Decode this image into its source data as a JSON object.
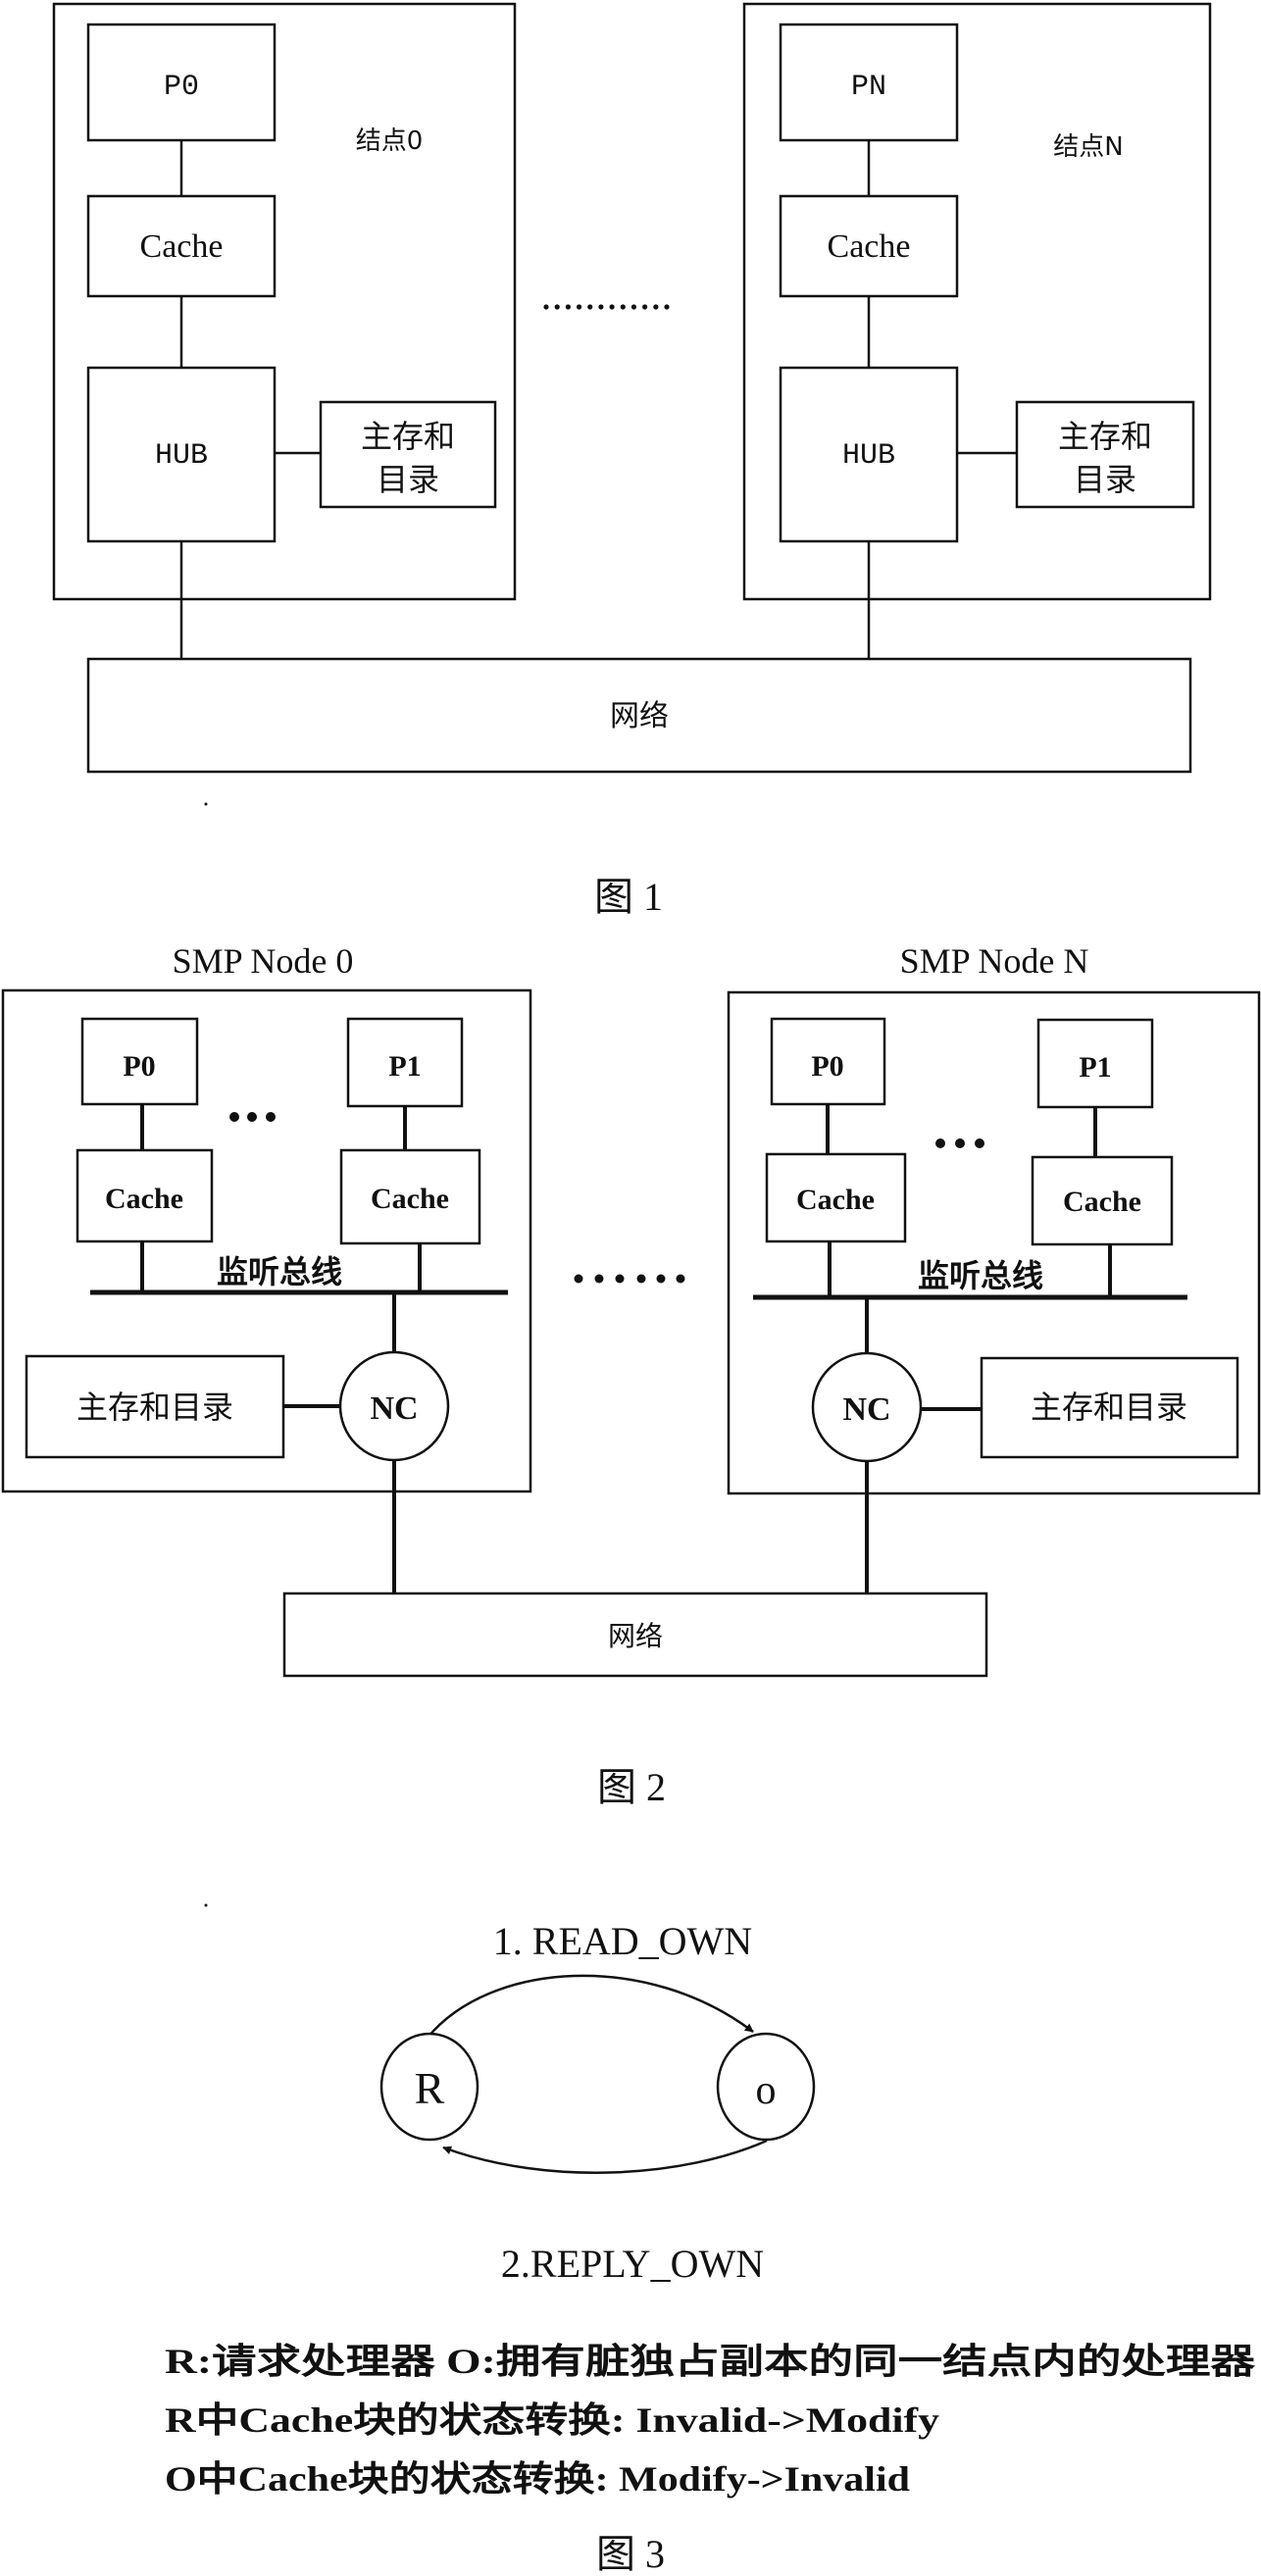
{
  "figure1": {
    "caption": "图 1",
    "nodes": [
      {
        "label": "结点0",
        "processor": "P0",
        "cache": "Cache",
        "hub": "HUB",
        "memory_line1": "主存和",
        "memory_line2": "目录"
      },
      {
        "label": "结点N",
        "processor": "PN",
        "cache": "Cache",
        "hub": "HUB",
        "memory_line1": "主存和",
        "memory_line2": "目录"
      }
    ],
    "ellipsis": "............",
    "network": "网络"
  },
  "figure2": {
    "caption": "图 2",
    "nodes": [
      {
        "title": "SMP Node 0",
        "processors": [
          "P0",
          "P1"
        ],
        "caches": [
          "Cache",
          "Cache"
        ],
        "ellipsis": "• • •",
        "bus_label": "监听总线",
        "controller": "NC",
        "memory": "主存和目录"
      },
      {
        "title": "SMP Node N",
        "processors": [
          "P0",
          "P1"
        ],
        "caches": [
          "Cache",
          "Cache"
        ],
        "ellipsis": "• • •",
        "bus_label": "监听总线",
        "controller": "NC",
        "memory": "主存和目录"
      }
    ],
    "between_nodes_ellipsis": "• • • • • •",
    "network": "网络"
  },
  "figure3": {
    "caption": "图 3",
    "states": [
      {
        "id": "R",
        "label": "R"
      },
      {
        "id": "O",
        "label": "o"
      }
    ],
    "transitions": [
      {
        "from": "R",
        "to": "O",
        "label": "1. READ_OWN"
      },
      {
        "from": "O",
        "to": "R",
        "label": "2.REPLY_OWN"
      }
    ],
    "legend": [
      "R:请求处理器    O:拥有脏独占副本的同一结点内的处理器",
      "R中Cache块的状态转换: Invalid->Modify",
      "O中Cache块的状态转换: Modify->Invalid"
    ]
  }
}
